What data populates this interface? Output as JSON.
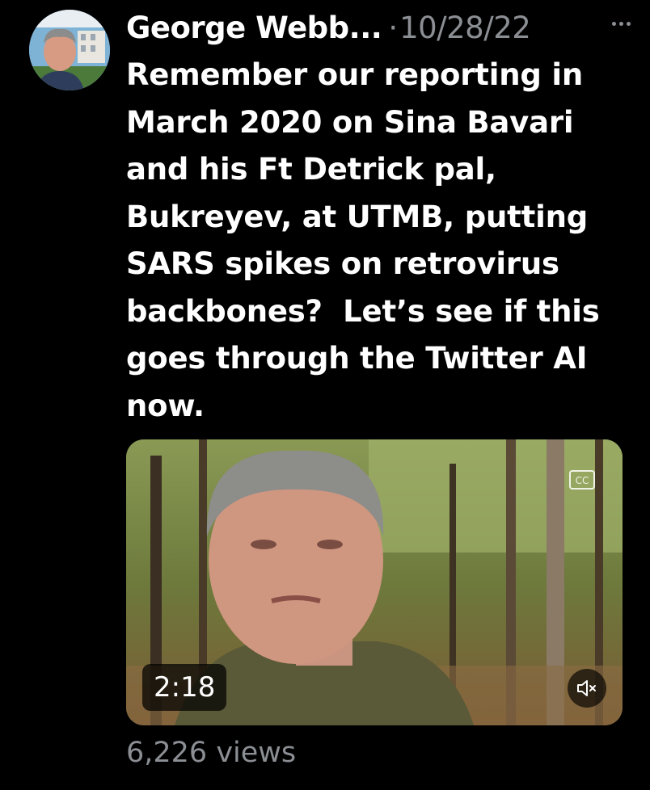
{
  "tweet": {
    "author_name": "George Webb...",
    "separator": "·",
    "timestamp": "10/28/22",
    "text": "Remember our reporting in\nMarch 2020 on Sina Bavari\nand his Ft Detrick pal,\nBukreyev, at UTMB, putting\nSARS spikes on retrovirus\nbackbones?  Let’s see if this\ngoes through the Twitter AI\nnow.",
    "video": {
      "duration": "2:18",
      "muted": true,
      "captions_icon": "cc-icon",
      "mute_icon": "speaker-muted-icon"
    },
    "views": "6,226 views"
  },
  "icons": {
    "more": "more-horizontal-icon",
    "avatar": "avatar"
  },
  "colors": {
    "background": "#000000",
    "text_primary": "#ffffff",
    "text_secondary": "#8b8f94"
  }
}
